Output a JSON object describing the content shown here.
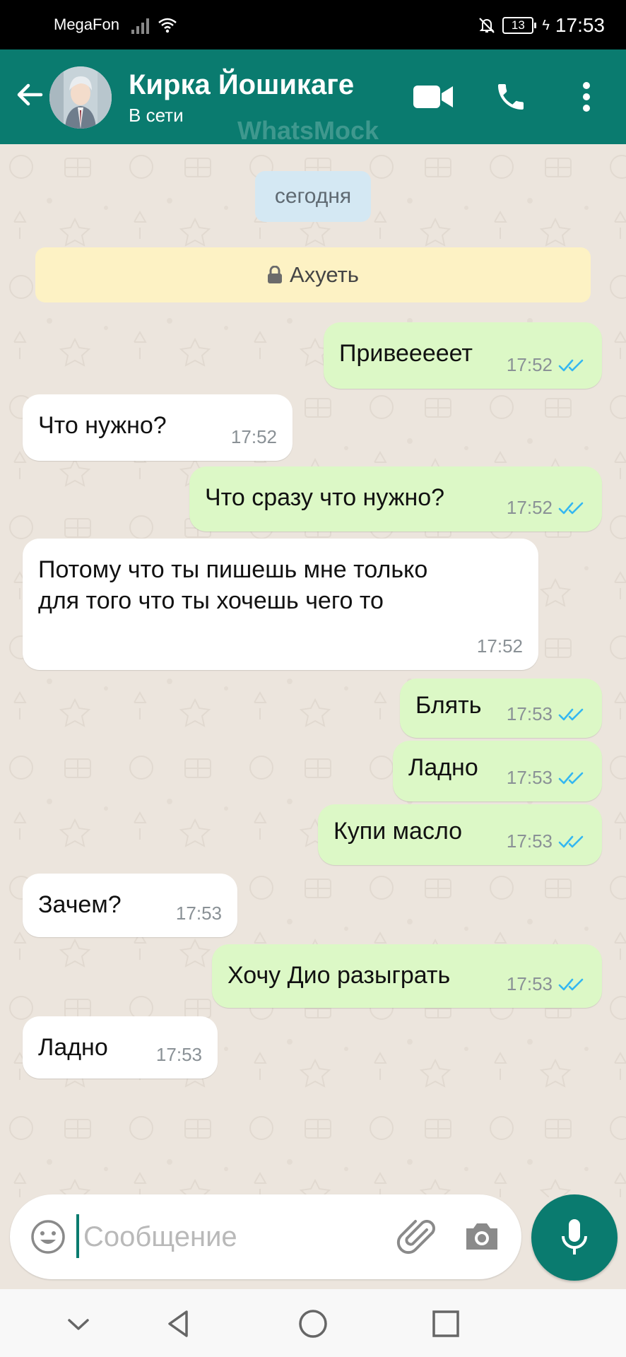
{
  "status_bar": {
    "carrier": "MegaFon",
    "battery": "13",
    "time": "17:53"
  },
  "header": {
    "contact_name": "Кирка Йошикаге",
    "contact_status": "В сети",
    "watermark": "WhatsMock"
  },
  "chat": {
    "date_label": "сегодня",
    "system_note": "Ахуеть",
    "messages": [
      {
        "direction": "out",
        "text": "Привееееет",
        "time": "17:52",
        "status": "read"
      },
      {
        "direction": "in",
        "text": "Что нужно?",
        "time": "17:52"
      },
      {
        "direction": "out",
        "text": "Что сразу что нужно?",
        "time": "17:52",
        "status": "read"
      },
      {
        "direction": "in",
        "text": "Потому что ты пишешь мне только\nдля того что ты хочешь чего то",
        "time": "17:52"
      },
      {
        "direction": "out",
        "text": "Блять",
        "time": "17:53",
        "status": "read"
      },
      {
        "direction": "out",
        "text": "Ладно",
        "time": "17:53",
        "status": "read"
      },
      {
        "direction": "out",
        "text": "Купи масло",
        "time": "17:53",
        "status": "read"
      },
      {
        "direction": "in",
        "text": "Зачем?",
        "time": "17:53"
      },
      {
        "direction": "out",
        "text": "Хочу Дио разыграть",
        "time": "17:53",
        "status": "read"
      },
      {
        "direction": "in",
        "text": "Ладно",
        "time": "17:53"
      }
    ]
  },
  "composer": {
    "placeholder": "Сообщение",
    "value": ""
  },
  "colors": {
    "header": "#0a7b6f",
    "outgoing_bubble": "#dcf8c6",
    "incoming_bubble": "#ffffff",
    "read_ticks": "#34b7f1",
    "chat_background": "#ece5dd"
  },
  "icons": {
    "header": [
      "back-arrow-icon",
      "avatar",
      "video-call-icon",
      "phone-icon",
      "more-vert-icon"
    ],
    "composer": [
      "emoji-icon",
      "attach-icon",
      "camera-icon",
      "mic-icon"
    ],
    "nav": [
      "nav-down-icon",
      "nav-back-icon",
      "nav-home-icon",
      "nav-recents-icon"
    ]
  }
}
